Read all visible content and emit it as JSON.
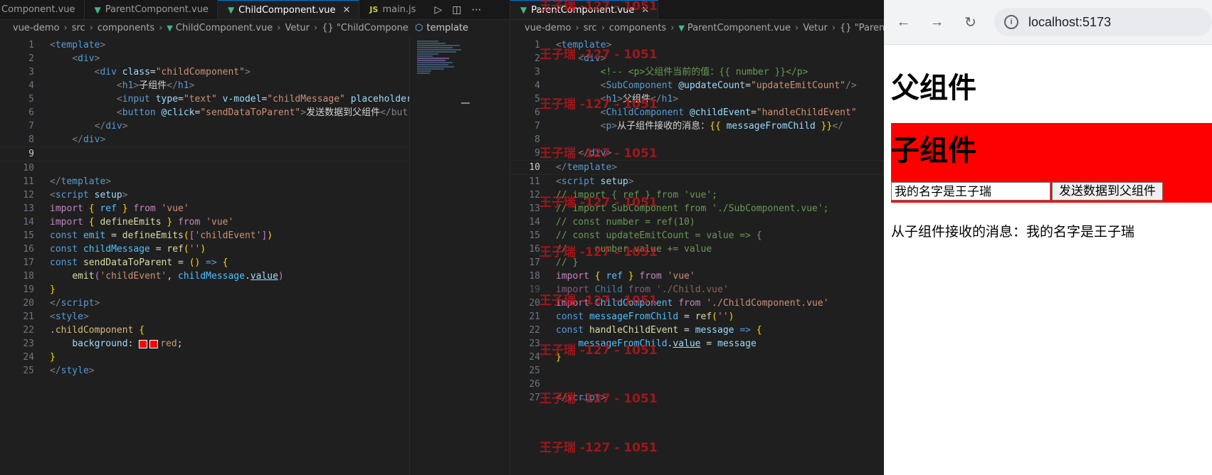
{
  "left_editor": {
    "tabs": [
      "Component.vue",
      "ParentComponent.vue",
      "ChildComponent.vue",
      "main.js"
    ],
    "breadcrumb": [
      "vue-demo",
      "src",
      "components",
      "ChildComponent.vue",
      "Vetur",
      "{} \"ChildComponent.vue\""
    ],
    "outline_label": "template",
    "lines": [
      {
        "n": "1"
      },
      {
        "n": "2"
      },
      {
        "n": "3"
      },
      {
        "n": "4"
      },
      {
        "n": "5"
      },
      {
        "n": "6"
      },
      {
        "n": "7"
      },
      {
        "n": "8"
      },
      {
        "n": "9"
      },
      {
        "n": "10"
      },
      {
        "n": "11"
      },
      {
        "n": "12"
      },
      {
        "n": "13"
      },
      {
        "n": "14"
      },
      {
        "n": "15"
      },
      {
        "n": "16"
      },
      {
        "n": "17"
      },
      {
        "n": "18"
      },
      {
        "n": "19"
      },
      {
        "n": "20"
      },
      {
        "n": "21"
      },
      {
        "n": "22"
      },
      {
        "n": "23"
      },
      {
        "n": "24"
      },
      {
        "n": "25"
      }
    ],
    "code": {
      "l1_tag": "template",
      "l2_tag": "div",
      "l3_tag": "div",
      "l3_attr": "class",
      "l3_val": "\"childComponent\"",
      "l4_tag": "h1",
      "l4_text": "子组件",
      "l5_tag": "input",
      "l5_a1": "type",
      "l5_v1": "\"text\"",
      "l5_a2": "v-model",
      "l5_v2": "\"childMessage\"",
      "l5_a3": "placeholder=",
      "l6_tag": "button",
      "l6_attr": "@click",
      "l6_val": "\"sendDataToParent\"",
      "l6_text": "发送数据到父组件",
      "l6_close": "</but",
      "l7_tag": "div",
      "l8_tag": "div",
      "l11_tag": "template",
      "l12_tag": "script",
      "l12_attr": "setup",
      "import": "import",
      "from": "from",
      "const": "const",
      "l13_name": "ref",
      "l13_mod": "'vue'",
      "l14_name": "defineEmits",
      "l14_mod": "'vue'",
      "l15_var": "emit",
      "l15_fn": "defineEmits",
      "l15_arg": "'childEvent'",
      "l16_var": "childMessage",
      "l16_fn": "ref",
      "l16_arg": "''",
      "l17_var": "sendDataToParent",
      "l18_fn": "emit",
      "l18_arg": "'childEvent'",
      "l18_var": "childMessage",
      "l18_prop": "value",
      "l20_tag": "script",
      "l21_tag": "style",
      "l22_sel": ".childComponent",
      "l23_prop": "background",
      "l23_val": "red",
      "l25_tag": "style"
    }
  },
  "right_editor": {
    "tab": "ParentComponent.vue",
    "breadcrumb": [
      "vue-demo",
      "src",
      "components",
      "ParentComponent.vue",
      "Vetur",
      "{} \"Parent"
    ],
    "lines": [
      {
        "n": "1"
      },
      {
        "n": "2"
      },
      {
        "n": "3"
      },
      {
        "n": "4"
      },
      {
        "n": "5"
      },
      {
        "n": "6"
      },
      {
        "n": "7"
      },
      {
        "n": "8"
      },
      {
        "n": "9"
      },
      {
        "n": "10"
      },
      {
        "n": "11"
      },
      {
        "n": "12"
      },
      {
        "n": "13"
      },
      {
        "n": "14"
      },
      {
        "n": "15"
      },
      {
        "n": "16"
      },
      {
        "n": "17"
      },
      {
        "n": "18"
      },
      {
        "n": "19"
      },
      {
        "n": "20"
      },
      {
        "n": "21"
      },
      {
        "n": "22"
      },
      {
        "n": "23"
      },
      {
        "n": "24"
      },
      {
        "n": "25"
      },
      {
        "n": "26"
      },
      {
        "n": "27"
      }
    ],
    "code": {
      "l1": "template",
      "l2": "div",
      "l3": "<!-- <p>父组件当前的值：{{ number }}</p>",
      "l4_tag": "SubComponent",
      "l4_attr": "@updateCount",
      "l4_val": "\"updateEmitCount\"",
      "l5_tag": "h1",
      "l5_text": "父组件",
      "l6_tag": "ChildComponent",
      "l6_attr": "@childEvent",
      "l6_val": "\"handleChildEvent\"",
      "l7_tag": "p",
      "l7_text": "从子组件接收的消息：",
      "l7_var": "messageFromChild",
      "l9": "div",
      "l10": "template",
      "l11_tag": "script",
      "l11_attr": "setup",
      "l12": "// import { ref } from 'vue';",
      "l13": "// import SubComponent from './SubComponent.vue';",
      "l14": "// const number = ref(10)",
      "l15": "// const updateEmitCount = value => {",
      "l16": "//     number.value += value",
      "l17": "// }",
      "import": "import",
      "from": "from",
      "const": "const",
      "l18_name": "ref",
      "l18_mod": "'vue'",
      "l19_name": "Child",
      "l19_mod": "'./Child.vue'",
      "l20_name": "ChildComponent",
      "l20_mod": "'./ChildComponent.vue'",
      "l21_var": "messageFromChild",
      "l21_fn": "ref",
      "l21_arg": "''",
      "l22_var": "handleChildEvent",
      "l22_param": "message",
      "l23_var": "messageFromChild",
      "l23_prop": "value",
      "l23_rhs": "message",
      "l27": "script"
    }
  },
  "watermark": "王子瑞 -127 - 1051",
  "browser": {
    "url": "localhost:5173",
    "parent_heading": "父组件",
    "child_heading": "子组件",
    "input_value": "我的名字是王子瑞",
    "send_button": "发送数据到父组件",
    "message": "从子组件接收的消息：我的名字是王子瑞"
  }
}
